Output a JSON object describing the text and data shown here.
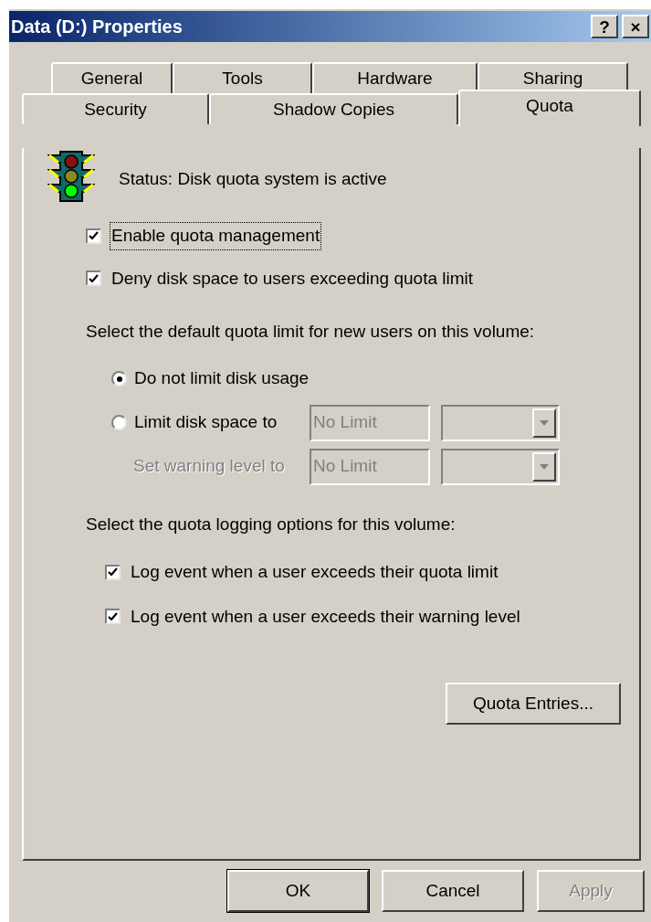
{
  "window": {
    "title": "Data (D:) Properties",
    "buttons": [
      "?",
      "×"
    ]
  },
  "tab_rows": [
    {
      "tabs": [
        {
          "label": "General",
          "selected": false
        },
        {
          "label": "Tools",
          "selected": false
        },
        {
          "label": "Hardware",
          "selected": false
        },
        {
          "label": "Sharing",
          "selected": false
        }
      ]
    },
    {
      "tabs": [
        {
          "label": "Security",
          "selected": false
        },
        {
          "label": "Shadow Copies",
          "selected": false
        },
        {
          "label": "Quota",
          "selected": true
        }
      ]
    }
  ],
  "status": "Status:  Disk quota system is active",
  "quota_checks": [
    {
      "label": "Enable quota management",
      "checked": true,
      "focused": true
    },
    {
      "label": "Deny disk space to users exceeding quota limit",
      "checked": true,
      "focused": false
    }
  ],
  "limit_prompt": "Select the default quota limit for new users on this volume:",
  "limit_options": [
    {
      "kind": "radio",
      "label": "Do not limit disk usage",
      "selected": true
    },
    {
      "kind": "radio",
      "label": "Limit disk space to",
      "selected": false,
      "value": "No Limit",
      "fields_disabled": true
    },
    {
      "kind": "label",
      "label": "Set warning level to",
      "disabled": true,
      "value": "No Limit",
      "fields_disabled": true
    }
  ],
  "logging_prompt": "Select the quota logging options for this volume:",
  "logging_checks": [
    {
      "label": "Log event when a user exceeds their quota limit",
      "checked": true
    },
    {
      "label": "Log event when a user exceeds their warning level",
      "checked": true
    }
  ],
  "entries_button": "Quota Entries...",
  "buttons": [
    {
      "label": "OK",
      "default": true,
      "disabled": false
    },
    {
      "label": "Cancel",
      "default": false,
      "disabled": false
    },
    {
      "label": "Apply",
      "default": false,
      "disabled": true
    }
  ]
}
